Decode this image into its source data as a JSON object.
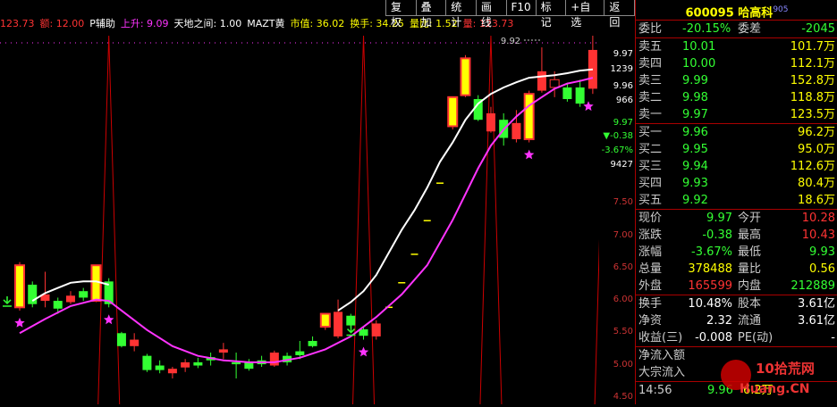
{
  "infobar": {
    "items": [
      {
        "label": "123.73",
        "color": "#ff3333"
      },
      {
        "label": "额: 12.00",
        "color": "#ff3333"
      },
      {
        "label": "P辅助",
        "color": "#ffffff"
      },
      {
        "label": "上升: 9.09",
        "color": "#ff33ff"
      },
      {
        "label": "天地之间: 1.00",
        "color": "#ffffff"
      },
      {
        "label": "MAZT黄",
        "color": "#ffffff"
      },
      {
        "label": "市值: 36.02",
        "color": "#ffff00"
      },
      {
        "label": "换手: 34.25",
        "color": "#ffff00"
      },
      {
        "label": "量比: 1.52",
        "color": "#ffff00"
      },
      {
        "label": "量: 123.73",
        "color": "#ff3333"
      }
    ]
  },
  "toolbar": [
    "复权",
    "叠加",
    "统计",
    "画线",
    "F10",
    "标记",
    "+自选",
    "返回"
  ],
  "axis": {
    "top_labels": [
      "9.97",
      "1239",
      "9.96",
      "966",
      "9.97",
      "▼-0.38",
      "-3.67%",
      "9427"
    ],
    "price_ticks": [
      "7.50",
      "7.00",
      "6.50",
      "6.00",
      "5.50",
      "5.00",
      "4.50"
    ]
  },
  "chart_annotation": "9.92",
  "panel": {
    "code": "600095",
    "name": "哈高科",
    "badge": "905",
    "weibi": {
      "label": "委比",
      "value": "-20.15%",
      "label2": "委差",
      "value2": "-2045"
    },
    "asks": [
      {
        "label": "卖五",
        "price": "10.01",
        "vol": "101.7万"
      },
      {
        "label": "卖四",
        "price": "10.00",
        "vol": "112.1万"
      },
      {
        "label": "卖三",
        "price": "9.99",
        "vol": "152.8万"
      },
      {
        "label": "卖二",
        "price": "9.98",
        "vol": "118.8万"
      },
      {
        "label": "卖一",
        "price": "9.97",
        "vol": "123.5万"
      }
    ],
    "bids": [
      {
        "label": "买一",
        "price": "9.96",
        "vol": "96.2万"
      },
      {
        "label": "买二",
        "price": "9.95",
        "vol": "95.0万"
      },
      {
        "label": "买三",
        "price": "9.94",
        "vol": "112.6万"
      },
      {
        "label": "买四",
        "price": "9.93",
        "vol": "80.4万"
      },
      {
        "label": "买五",
        "price": "9.92",
        "vol": "18.6万"
      }
    ],
    "stats": [
      {
        "l1": "现价",
        "v1": "9.97",
        "c1": "green",
        "l2": "今开",
        "v2": "10.28",
        "c2": "red"
      },
      {
        "l1": "涨跌",
        "v1": "-0.38",
        "c1": "green",
        "l2": "最高",
        "v2": "10.43",
        "c2": "red"
      },
      {
        "l1": "涨幅",
        "v1": "-3.67%",
        "c1": "green",
        "l2": "最低",
        "v2": "9.93",
        "c2": "green"
      },
      {
        "l1": "总量",
        "v1": "378488",
        "c1": "yellow",
        "l2": "量比",
        "v2": "0.56",
        "c2": "yellow"
      },
      {
        "l1": "外盘",
        "v1": "165599",
        "c1": "red",
        "l2": "内盘",
        "v2": "212889",
        "c2": "green"
      }
    ],
    "stats2": [
      {
        "l1": "换手",
        "v1": "10.48%",
        "l2": "股本",
        "v2": "3.61亿"
      },
      {
        "l1": "净资",
        "v1": "2.32",
        "l2": "流通",
        "v2": "3.61亿"
      },
      {
        "l1": "收益(三)",
        "v1": "-0.008",
        "l2": "PE(动)",
        "v2": "-"
      }
    ],
    "flow": [
      {
        "label": "净流入额",
        "value": ""
      },
      {
        "label": "大宗流入",
        "value": ""
      }
    ],
    "tick": {
      "time": "14:56",
      "price": "9.96",
      "vol": "6.2万"
    }
  },
  "watermark": {
    "text": "10拾荒网",
    "url": "Huang.CN"
  },
  "colors": {
    "up": "#ff3333",
    "down": "#33ff33",
    "ma_white": "#ffffff",
    "ma_magenta": "#ff33ff",
    "spike": "#cc0000",
    "yellow": "#ffff00"
  },
  "chart_data": {
    "type": "candlestick",
    "ylim": [
      4.4,
      10.1
    ],
    "candles": [
      {
        "o": 5.9,
        "c": 6.55,
        "h": 6.6,
        "l": 5.85,
        "k": "limit"
      },
      {
        "o": 6.25,
        "c": 5.95,
        "h": 6.3,
        "l": 5.9,
        "k": "down"
      },
      {
        "o": 6.0,
        "c": 6.1,
        "h": 6.45,
        "l": 5.9,
        "k": "up"
      },
      {
        "o": 6.0,
        "c": 5.88,
        "h": 6.05,
        "l": 5.8,
        "k": "down"
      },
      {
        "o": 5.98,
        "c": 6.08,
        "h": 6.15,
        "l": 5.95,
        "k": "up"
      },
      {
        "o": 6.15,
        "c": 6.05,
        "h": 6.2,
        "l": 6.0,
        "k": "down"
      },
      {
        "o": 6.0,
        "c": 6.55,
        "h": 6.55,
        "l": 5.98,
        "k": "limit"
      },
      {
        "o": 6.3,
        "c": 5.95,
        "h": 6.35,
        "l": 5.9,
        "k": "down"
      },
      {
        "o": 5.5,
        "c": 5.3,
        "h": 5.52,
        "l": 5.28,
        "k": "down"
      },
      {
        "o": 5.3,
        "c": 5.4,
        "h": 5.5,
        "l": 5.22,
        "k": "up"
      },
      {
        "o": 5.15,
        "c": 4.93,
        "h": 5.18,
        "l": 4.9,
        "k": "down"
      },
      {
        "o": 5.0,
        "c": 4.93,
        "h": 5.08,
        "l": 4.88,
        "k": "down"
      },
      {
        "o": 4.88,
        "c": 4.95,
        "h": 4.98,
        "l": 4.8,
        "k": "up"
      },
      {
        "o": 4.97,
        "c": 5.05,
        "h": 5.1,
        "l": 4.9,
        "k": "up"
      },
      {
        "o": 5.05,
        "c": 5.0,
        "h": 5.12,
        "l": 4.96,
        "k": "down"
      },
      {
        "o": 5.13,
        "c": 5.08,
        "h": 5.2,
        "l": 5.0,
        "k": "down"
      },
      {
        "o": 5.2,
        "c": 5.25,
        "h": 5.35,
        "l": 5.1,
        "k": "up"
      },
      {
        "o": 5.05,
        "c": 5.02,
        "h": 5.2,
        "l": 4.8,
        "k": "down"
      },
      {
        "o": 5.05,
        "c": 4.95,
        "h": 5.1,
        "l": 4.92,
        "k": "down"
      },
      {
        "o": 5.08,
        "c": 5.02,
        "h": 5.15,
        "l": 4.98,
        "k": "down"
      },
      {
        "o": 5.0,
        "c": 5.2,
        "h": 5.23,
        "l": 4.98,
        "k": "up"
      },
      {
        "o": 5.15,
        "c": 5.05,
        "h": 5.2,
        "l": 5.0,
        "k": "down"
      },
      {
        "o": 5.22,
        "c": 5.16,
        "h": 5.38,
        "l": 5.1,
        "k": "down"
      },
      {
        "o": 5.38,
        "c": 5.3,
        "h": 5.45,
        "l": 5.28,
        "k": "down"
      },
      {
        "o": 5.6,
        "c": 5.8,
        "h": 5.8,
        "l": 5.55,
        "k": "limit"
      },
      {
        "o": 5.45,
        "c": 5.83,
        "h": 6.02,
        "l": 5.42,
        "k": "up"
      },
      {
        "o": 5.77,
        "c": 5.62,
        "h": 5.8,
        "l": 5.58,
        "k": "down"
      },
      {
        "o": 5.56,
        "c": 5.46,
        "h": 5.6,
        "l": 5.4,
        "k": "down"
      },
      {
        "o": 5.45,
        "c": 5.65,
        "h": 5.7,
        "l": 5.4,
        "k": "up"
      },
      {
        "o": 5.9,
        "c": 5.9,
        "h": 5.9,
        "l": 5.9,
        "k": "flat"
      },
      {
        "o": 6.28,
        "c": 6.28,
        "h": 6.28,
        "l": 6.28,
        "k": "flat"
      },
      {
        "o": 6.72,
        "c": 6.72,
        "h": 6.72,
        "l": 6.72,
        "k": "flat"
      },
      {
        "o": 7.24,
        "c": 7.24,
        "h": 7.24,
        "l": 7.24,
        "k": "flat"
      },
      {
        "o": 7.82,
        "c": 7.82,
        "h": 7.82,
        "l": 7.82,
        "k": "flat"
      },
      {
        "o": 9.15,
        "c": 8.7,
        "h": 9.15,
        "l": 8.65,
        "k": "limit"
      },
      {
        "o": 9.75,
        "c": 9.18,
        "h": 9.8,
        "l": 9.15,
        "k": "limit"
      },
      {
        "o": 9.12,
        "c": 8.8,
        "h": 9.18,
        "l": 8.78,
        "k": "down"
      },
      {
        "o": 8.62,
        "c": 8.9,
        "h": 9.0,
        "l": 8.6,
        "k": "up"
      },
      {
        "o": 8.8,
        "c": 8.52,
        "h": 8.9,
        "l": 8.4,
        "k": "down"
      },
      {
        "o": 8.5,
        "c": 8.75,
        "h": 8.95,
        "l": 8.45,
        "k": "up"
      },
      {
        "o": 9.2,
        "c": 8.5,
        "h": 9.25,
        "l": 8.45,
        "k": "limit"
      },
      {
        "o": 9.55,
        "c": 9.25,
        "h": 9.92,
        "l": 9.22,
        "k": "up"
      },
      {
        "o": 9.3,
        "c": 9.42,
        "h": 9.55,
        "l": 9.15,
        "k": "up"
      },
      {
        "o": 9.3,
        "c": 9.12,
        "h": 9.35,
        "l": 9.08,
        "k": "down"
      },
      {
        "o": 9.3,
        "c": 9.05,
        "h": 9.42,
        "l": 9.0,
        "k": "down"
      },
      {
        "o": 9.88,
        "c": 9.28,
        "h": 10.1,
        "l": 9.2,
        "k": "up"
      }
    ],
    "ma_white": [
      [
        1,
        6.0
      ],
      [
        2,
        6.12
      ],
      [
        3,
        6.2
      ],
      [
        4,
        6.28
      ],
      [
        5,
        6.3
      ],
      [
        6,
        6.3
      ],
      [
        7,
        6.25
      ],
      [
        25,
        5.85
      ],
      [
        26,
        5.98
      ],
      [
        27,
        6.15
      ],
      [
        28,
        6.4
      ],
      [
        29,
        6.75
      ],
      [
        30,
        7.1
      ],
      [
        31,
        7.4
      ],
      [
        32,
        7.75
      ],
      [
        33,
        8.15
      ],
      [
        34,
        8.45
      ],
      [
        35,
        8.8
      ],
      [
        36,
        9.05
      ],
      [
        37,
        9.2
      ],
      [
        38,
        9.3
      ],
      [
        39,
        9.38
      ],
      [
        40,
        9.45
      ],
      [
        41,
        9.47
      ],
      [
        42,
        9.49
      ],
      [
        43,
        9.52
      ],
      [
        44,
        9.56
      ],
      [
        45,
        9.58
      ]
    ],
    "ma_magenta": [
      [
        0,
        5.5
      ],
      [
        2,
        5.72
      ],
      [
        4,
        5.92
      ],
      [
        6,
        6.02
      ],
      [
        7,
        6.0
      ],
      [
        8,
        5.85
      ],
      [
        10,
        5.55
      ],
      [
        12,
        5.3
      ],
      [
        14,
        5.15
      ],
      [
        16,
        5.08
      ],
      [
        18,
        5.05
      ],
      [
        20,
        5.05
      ],
      [
        22,
        5.12
      ],
      [
        24,
        5.25
      ],
      [
        26,
        5.45
      ],
      [
        28,
        5.75
      ],
      [
        30,
        6.1
      ],
      [
        32,
        6.55
      ],
      [
        34,
        7.25
      ],
      [
        35,
        7.65
      ],
      [
        36,
        8.05
      ],
      [
        37,
        8.4
      ],
      [
        38,
        8.65
      ],
      [
        39,
        8.85
      ],
      [
        40,
        9.02
      ],
      [
        41,
        9.15
      ],
      [
        42,
        9.28
      ],
      [
        43,
        9.36
      ],
      [
        44,
        9.4
      ],
      [
        45,
        9.45
      ]
    ],
    "spikes": [
      7,
      27,
      37,
      46
    ],
    "stars": [
      0,
      7,
      27,
      40,
      46
    ],
    "arrows": [
      0,
      27
    ]
  }
}
